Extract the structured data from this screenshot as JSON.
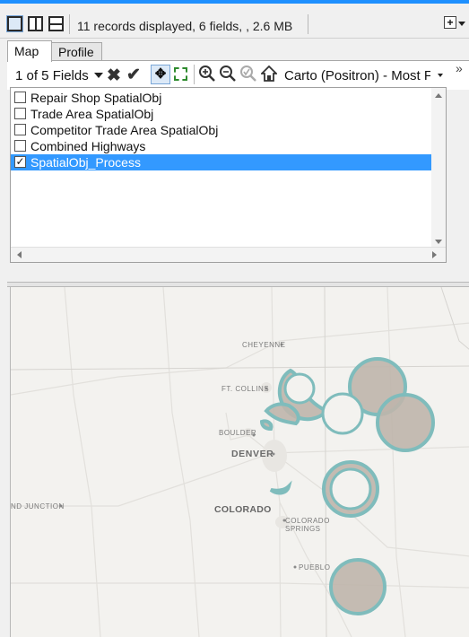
{
  "toolbar": {
    "status": "11 records displayed, 6 fields, , 2.6 MB",
    "layout_buttons": [
      "single-panel-icon",
      "split-vertical-icon",
      "split-horizontal-icon"
    ]
  },
  "tabs": [
    {
      "label": "Map",
      "selected": true
    },
    {
      "label": "Profile",
      "selected": false
    }
  ],
  "map_toolbar": {
    "fields_dropdown": "1 of 5 Fields",
    "basemap_dropdown": "Carto (Positron) - Most F",
    "overflow": "»"
  },
  "layers": [
    {
      "label": "Repair Shop SpatialObj",
      "checked": false
    },
    {
      "label": "Trade Area SpatialObj",
      "checked": false
    },
    {
      "label": "Competitor Trade Area SpatialObj",
      "checked": false
    },
    {
      "label": "Combined Highways",
      "checked": false
    },
    {
      "label": "SpatialObj_Process",
      "checked": true,
      "selected": true
    }
  ],
  "map": {
    "cities": [
      "CHEYENNE",
      "FT. COLLINS",
      "BOULDER",
      "DENVER",
      "ND JUNCTION",
      "COLORADO SPRINGS",
      "PUEBLO"
    ],
    "state": "COLORADO",
    "colors": {
      "fill": "#bfb5ab",
      "stroke": "#7fbcbc",
      "background": "#f3f2ef"
    }
  }
}
